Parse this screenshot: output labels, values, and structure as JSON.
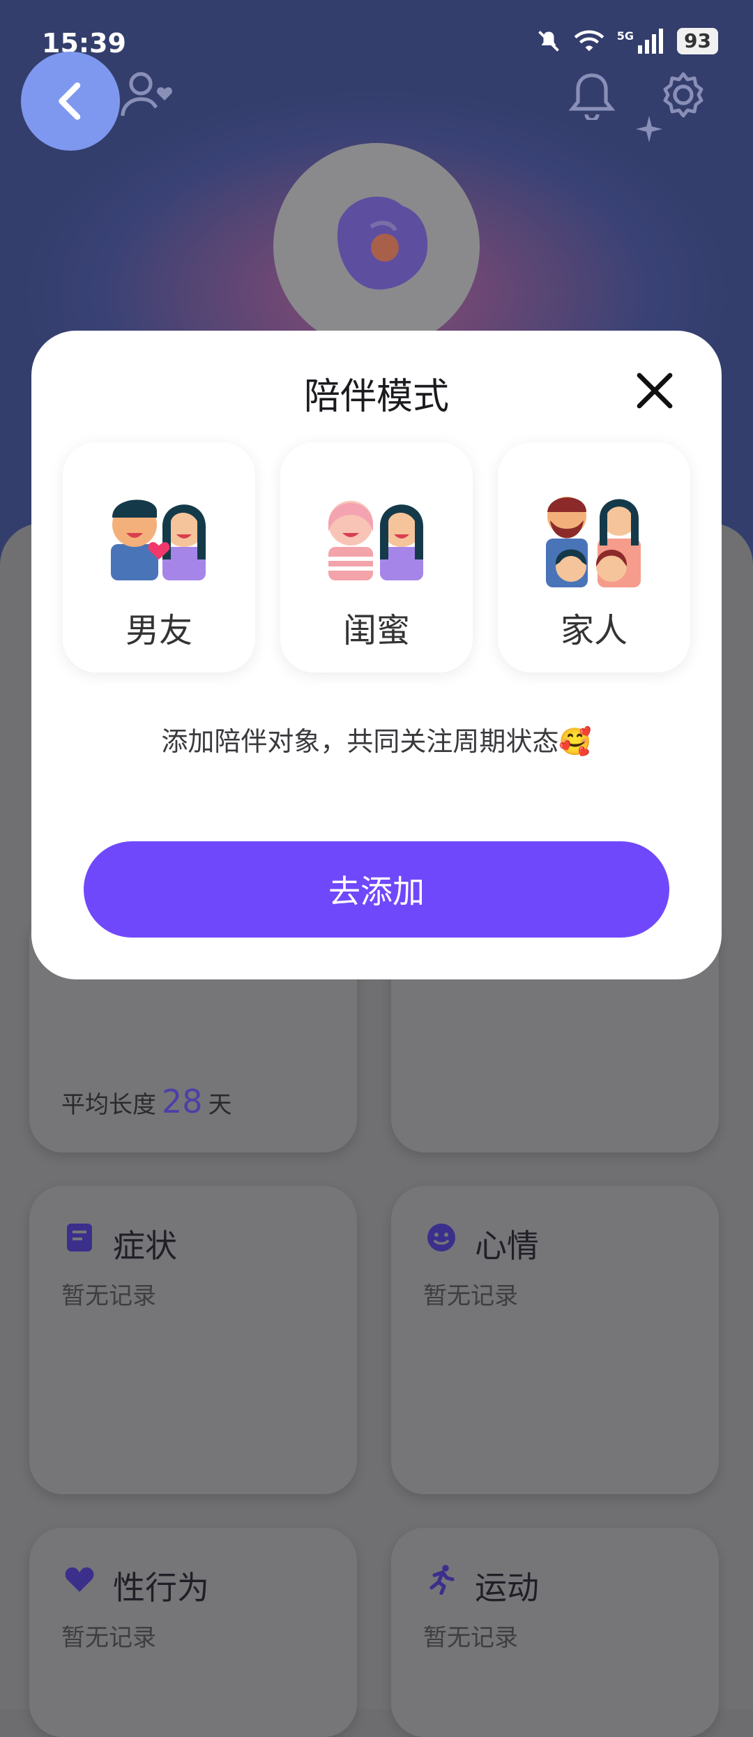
{
  "status_bar": {
    "time": "15:39",
    "battery": "93",
    "network": "5G"
  },
  "modal": {
    "title": "陪伴模式",
    "options": [
      {
        "label": "男友"
      },
      {
        "label": "闺蜜"
      },
      {
        "label": "家人"
      }
    ],
    "description": "添加陪伴对象，共同关注周期状态🥰",
    "button_label": "去添加"
  },
  "cards": {
    "cycle": {
      "avg_prefix": "平均长度",
      "avg_value": "28",
      "avg_unit": "天"
    },
    "symptoms": {
      "title": "症状",
      "subtitle": "暂无记录"
    },
    "mood": {
      "title": "心情",
      "subtitle": "暂无记录"
    },
    "sex": {
      "title": "性行为",
      "subtitle": "暂无记录"
    },
    "exercise": {
      "title": "运动",
      "subtitle": "暂无记录"
    }
  },
  "colors": {
    "accent": "#7048fb",
    "back_button": "#7f98ef"
  }
}
